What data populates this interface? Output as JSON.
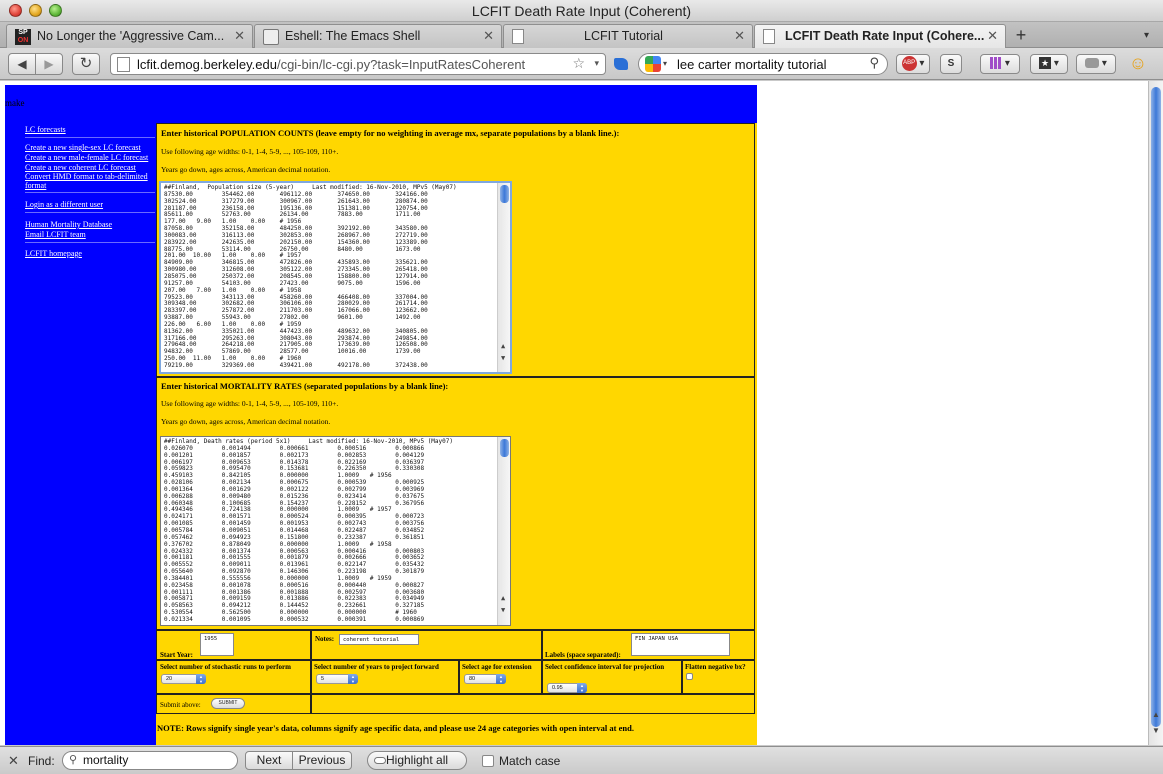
{
  "window": {
    "title": "LCFIT Death Rate Input (Coherent)"
  },
  "tabs": [
    {
      "label": "No Longer the 'Aggressive Cam...",
      "icon": "spiegel-favicon",
      "favicon_text": [
        "SP",
        "ON"
      ]
    },
    {
      "label": "Eshell: The Emacs Shell",
      "icon": "terminal-favicon"
    },
    {
      "label": "LCFIT Tutorial",
      "icon": "page-favicon"
    },
    {
      "label": "LCFIT Death Rate Input (Cohere...",
      "icon": "page-favicon",
      "active": true
    }
  ],
  "tabbar": {
    "new_tab_label": "+",
    "close_glyph": "✕",
    "list_glyph": "▾"
  },
  "nav": {
    "back_glyph": "◀",
    "forward_glyph": "▶",
    "reload_glyph": "↻",
    "url_host": "lcfit.demog.berkeley.edu",
    "url_path": "/cgi-bin/lc-cgi.py?task=InputRatesCoherent",
    "star_glyph": "☆",
    "search_value": "lee carter mortality tutorial",
    "search_glyph": "⚲",
    "ext_abp": "ABP",
    "ext_s": "S",
    "ext_smiley": "☺"
  },
  "page": {
    "header_text": "make",
    "colors": {
      "blue": "#0000ff",
      "gold": "#ffd700"
    },
    "sidebar": {
      "links": [
        {
          "label": "LC forecasts"
        },
        {
          "label": "Create a new single-sex LC forecast"
        },
        {
          "label": "Create a new male-female LC forecast"
        },
        {
          "label": "Create a new coherent LC forecast"
        },
        {
          "label": "Convert HMD format to tab-delimited format"
        },
        {
          "label": "Login as a different user"
        },
        {
          "label": "Human Mortality Database"
        },
        {
          "label": "Email LCFIT team"
        },
        {
          "label": "LCFIT homepage"
        }
      ]
    },
    "population": {
      "title": "Enter historical POPULATION COUNTS (leave empty for no weighting in average mx, separate populations by a blank line.):",
      "age_note": "Use following age widths: 0-1, 1-4, 5-9, ..., 105-109, 110+.",
      "years_note": "Years go down, ages across, American decimal notation.",
      "lines": [
        "##Finland,  Population size (5-year)     Last modified: 16-Nov-2010, MPv5 (May07)",
        "87530.00        354462.00       496112.00       374650.00       324166.00",
        "302524.00       317279.00       300967.00       261643.00       280874.00",
        "281187.00       236158.00       195136.00       151381.00       120754.00",
        "85611.00        52763.00        26134.00        7883.00         1711.00",
        "177.00   9.00   1.00    0.00    # 1956",
        "87058.00        352158.00       484250.00       392192.00       343580.00",
        "300083.00       316113.00       302853.00       268967.00       272719.00",
        "283922.00       242635.00       202150.00       154360.00       123389.00",
        "88775.00        53114.00        26750.00        8480.00         1673.00",
        "201.00  10.00   1.00    0.00    # 1957",
        "84909.00        346815.00       472826.00       435893.00       335621.00",
        "300980.00       312608.00       305122.00       273345.00       265418.00",
        "285075.00       250372.00       208545.00       158800.00       127914.00",
        "91257.00        54103.00        27423.00        9075.00         1596.00",
        "207.00   7.00   1.00    0.00    # 1958",
        "79523.00        343113.00       458260.00       466408.00       337004.00",
        "309348.00       302682.00       306106.00       280029.00       261714.00",
        "283397.00       257872.00       211703.00       167066.00       123662.00",
        "93887.00        55943.00        27802.00        9601.00         1492.00",
        "226.00   6.00   1.00    0.00    # 1959",
        "81362.00        335021.00       447423.00       489632.00       340805.00",
        "317166.00       295263.00       308043.00       293874.00       249854.00",
        "279648.00       264218.00       217905.00       173639.00       126508.00",
        "94832.00        57869.00        28577.00        10016.00        1739.00",
        "250.00  11.00   1.00    0.00    # 1960",
        "79219.00        329369.00       439421.00       492178.00       372438.00"
      ]
    },
    "mortality": {
      "title": "Enter historical MORTALITY RATES (separated populations by a blank line):",
      "age_note": "Use following age widths: 0-1, 1-4, 5-9, ..., 105-109, 110+.",
      "years_note": "Years go down, ages across, American decimal notation.",
      "lines": [
        "##Finland, Death rates (period 5x1)     Last modified: 16-Nov-2010, MPv5 (May07)",
        "0.026070        0.001494        0.000661        0.000516        0.000866",
        "0.001201        0.001857        0.002173        0.002853        0.004129",
        "0.006197        0.009653        0.014378        0.022169        0.036397",
        "0.059823        0.095470        0.153681        0.226350        0.330308",
        "0.459103        0.842105        0.000000        1.0009   # 1956",
        "0.028106        0.002134        0.000675        0.000539        0.000925",
        "0.001364        0.001629        0.002122        0.002799        0.003969",
        "0.006288        0.009480        0.015236        0.023414        0.037675",
        "0.060348        0.100685        0.154237        0.228152        0.367956",
        "0.494346        0.724138        0.000000        1.0009   # 1957",
        "0.024171        0.001571        0.000524        0.000395        0.000723",
        "0.001085        0.001459        0.001953        0.002743        0.003756",
        "0.005784        0.009051        0.014468        0.022487        0.034852",
        "0.057462        0.094923        0.151800        0.232387        0.361851",
        "0.376702        0.878049        0.000000        1.0009   # 1958",
        "0.024332        0.001374        0.000563        0.000416        0.000803",
        "0.001181        0.001555        0.001879        0.002666        0.003652",
        "0.005552        0.009011        0.013961        0.022147        0.035432",
        "0.055640        0.092870        0.146306        0.223198        0.301879",
        "0.384401        0.555556        0.000000        1.0009   # 1959",
        "0.023458        0.001078        0.000516        0.000440        0.000827",
        "0.001111        0.001386        0.001888        0.002597        0.003680",
        "0.005871        0.009159        0.013886        0.022383        0.034949",
        "0.058563        0.094212        0.144452        0.232661        0.327185",
        "0.530554        0.562500        0.000000        0.000000        # 1960",
        "0.021334        0.001095        0.000532        0.000391        0.000869"
      ]
    },
    "form": {
      "start_year_label": "Start Year:",
      "start_year_value": "1955",
      "notes_label": "Notes:",
      "notes_value": "coherent tutorial",
      "labels_label": "Labels (space separated):",
      "labels_value": "FIN JAPAN USA",
      "runs_label": "Select number of stochastic runs to perform",
      "runs_value": "20",
      "years_forward_label": "Select number of years to project forward",
      "years_forward_value": "5",
      "age_extension_label": "Select age for extension",
      "age_extension_value": "80",
      "confidence_label": "Select confidence interval for projection",
      "confidence_value": "0.95",
      "flatten_label": "Flatten negative bx?",
      "submit_label": "Submit above:",
      "submit_button": "SUBMIT",
      "note": "NOTE: Rows signify single year's data, columns signify age specific data, and please use 24 age categories with open interval at end."
    },
    "scroll_glyphs": {
      "up": "▲",
      "down": "▼"
    }
  },
  "findbar": {
    "close_glyph": "✕",
    "label": "Find:",
    "value": "mortality",
    "next": "Next",
    "previous": "Previous",
    "highlight_all": "Highlight all",
    "match_case": "Match case",
    "mag_glyph": "⚲"
  }
}
